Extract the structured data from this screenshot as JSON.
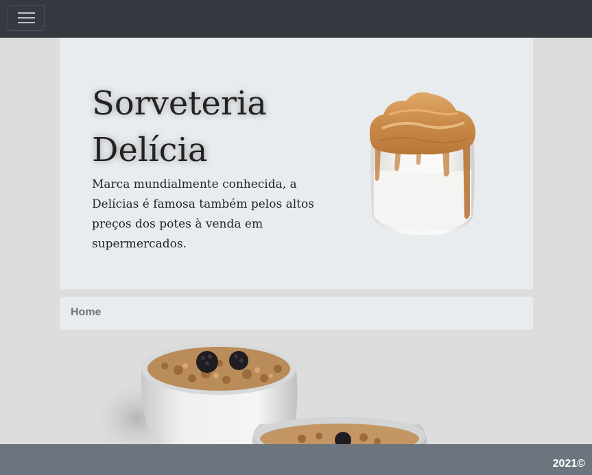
{
  "navbar": {
    "toggler_icon": "hamburger-menu-icon",
    "background": "#343a40"
  },
  "hero": {
    "title": "Sorveteria Delícia",
    "lead": "Marca mundialmente conhecida, a Delícias é famosa também pelos altos preços dos potes à venda em supermercados.",
    "image": "dalgona-coffee-jar-image",
    "background": "#e9ecef"
  },
  "breadcrumb": {
    "items": [
      "Home"
    ]
  },
  "product": {
    "image": "yogurt-granola-blackberry-jars-image"
  },
  "footer": {
    "text": "2021©",
    "background": "#6c757d"
  }
}
